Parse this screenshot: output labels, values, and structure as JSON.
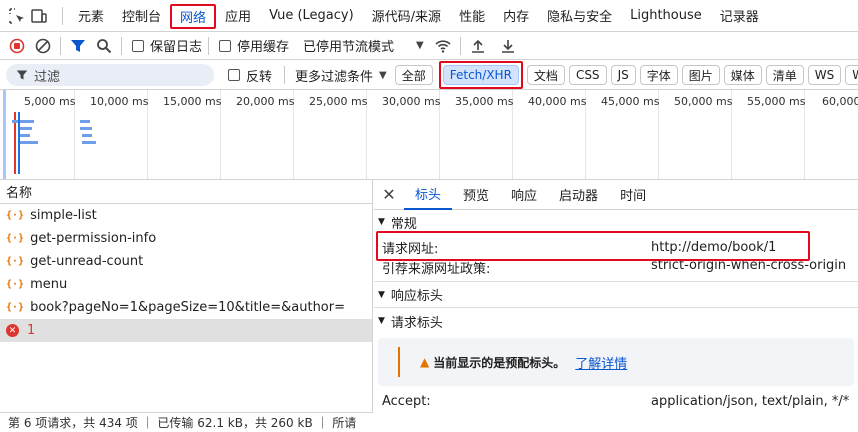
{
  "tabs": [
    {
      "label": "元素"
    },
    {
      "label": "控制台"
    },
    {
      "label": "网络",
      "active": true
    },
    {
      "label": "应用"
    },
    {
      "label": "Vue (Legacy)"
    },
    {
      "label": "源代码/来源"
    },
    {
      "label": "性能"
    },
    {
      "label": "内存"
    },
    {
      "label": "隐私与安全"
    },
    {
      "label": "Lighthouse"
    },
    {
      "label": "记录器"
    }
  ],
  "toolbar": {
    "preserve_log": "保留日志",
    "disable_cache": "停用缓存",
    "throttle": "已停用节流模式"
  },
  "filter": {
    "placeholder": "过滤",
    "invert": "反转",
    "more_filters": "更多过滤条件",
    "chips": [
      "全部",
      "Fetch/XHR",
      "文档",
      "CSS",
      "JS",
      "字体",
      "图片",
      "媒体",
      "清单",
      "WS",
      "W"
    ]
  },
  "timeline": {
    "ticks": [
      "5,000 ms",
      "10,000 ms",
      "15,000 ms",
      "20,000 ms",
      "25,000 ms",
      "30,000 ms",
      "35,000 ms",
      "40,000 ms",
      "45,000 ms",
      "50,000 ms",
      "55,000 ms",
      "60,000"
    ]
  },
  "requests": {
    "header": "名称",
    "items": [
      {
        "name": "simple-list",
        "error": false
      },
      {
        "name": "get-permission-info",
        "error": false
      },
      {
        "name": "get-unread-count",
        "error": false
      },
      {
        "name": "menu",
        "error": false
      },
      {
        "name": "book?pageNo=1&pageSize=10&title=&author=",
        "error": false
      },
      {
        "name": "1",
        "error": true
      }
    ]
  },
  "details": {
    "tabs": [
      "标头",
      "预览",
      "响应",
      "启动器",
      "时间"
    ],
    "general": "常规",
    "request_url_label": "请求网址:",
    "request_url": "http://demo/book/1",
    "referrer_label": "引荐来源网址政策:",
    "referrer": "strict-origin-when-cross-origin",
    "response_headers": "响应标头",
    "request_headers": "请求标头",
    "warning": "当前显示的是预配标头。",
    "learn_more": "了解详情",
    "accept_label": "Accept:",
    "accept": "application/json, text/plain, */*"
  },
  "status": "第 6 项请求，共 434 项 ｜ 已传输 62.1 kB，共 260 kB ｜ 所请",
  "colors": {
    "accent": "#0b57d0",
    "highlight": "#e3091c",
    "record": "#dc362e"
  }
}
